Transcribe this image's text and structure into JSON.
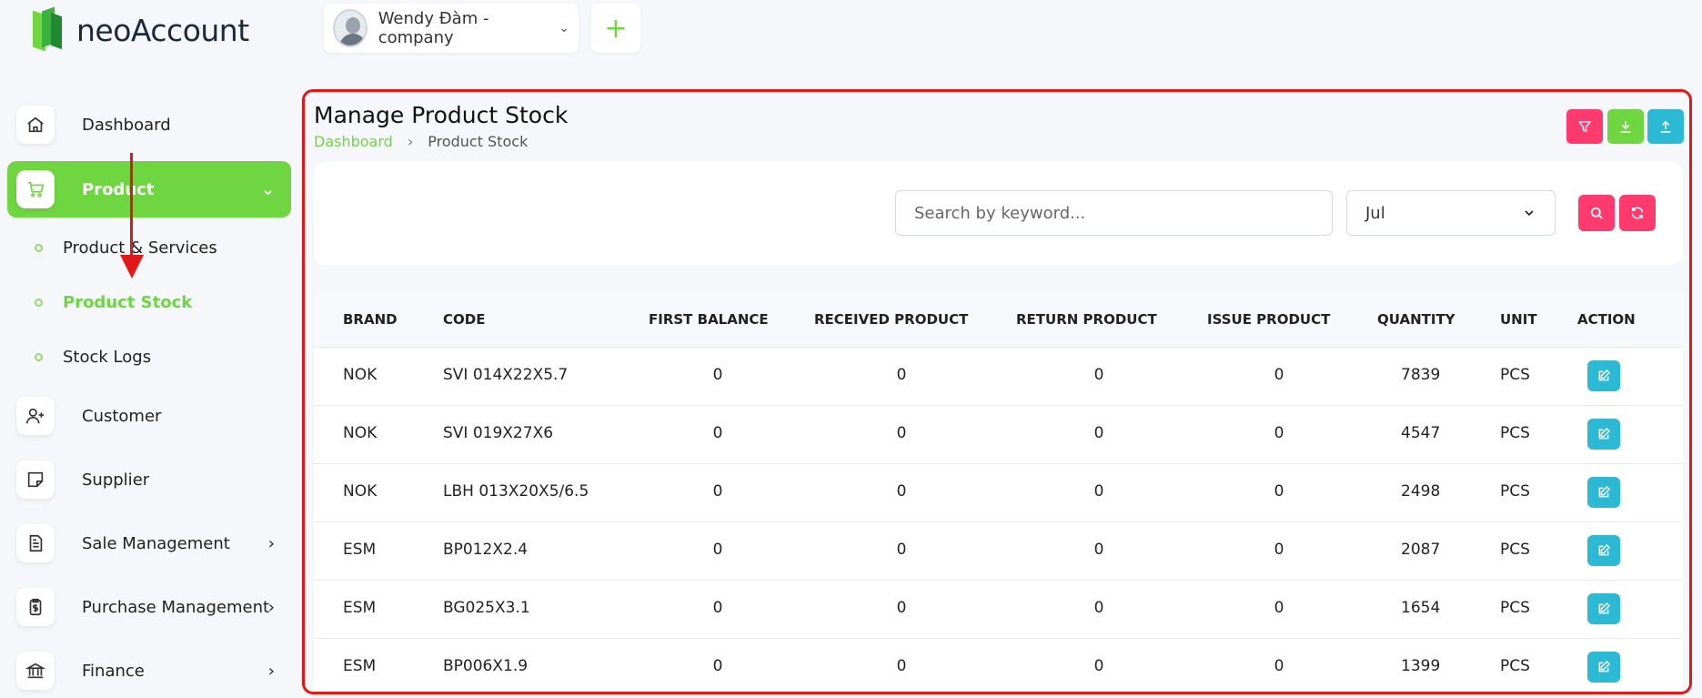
{
  "app": {
    "name": "neoAccount"
  },
  "header": {
    "company": "Wendy Đàm - company",
    "add_label": "+"
  },
  "sidebar": {
    "items": [
      {
        "label": "Dashboard",
        "icon": "home-icon"
      },
      {
        "label": "Product",
        "icon": "cart-icon"
      },
      {
        "label": "Customer",
        "icon": "user-plus-icon"
      },
      {
        "label": "Supplier",
        "icon": "sticky-note-icon"
      },
      {
        "label": "Sale Management",
        "icon": "invoice-icon"
      },
      {
        "label": "Purchase Management",
        "icon": "receipt-dollar-icon"
      },
      {
        "label": "Finance",
        "icon": "bank-icon"
      }
    ],
    "sub_items": [
      {
        "label": "Product & Services"
      },
      {
        "label": "Product Stock"
      },
      {
        "label": "Stock Logs"
      }
    ]
  },
  "page": {
    "title": "Manage Product Stock",
    "breadcrumb": {
      "home": "Dashboard",
      "current": "Product Stock"
    }
  },
  "filters": {
    "search_placeholder": "Search by keyword...",
    "month": "Jul"
  },
  "table": {
    "headers": [
      "BRAND",
      "CODE",
      "FIRST BALANCE",
      "RECEIVED PRODUCT",
      "RETURN PRODUCT",
      "ISSUE PRODUCT",
      "QUANTITY",
      "UNIT",
      "ACTION"
    ],
    "rows": [
      {
        "brand": "NOK",
        "code": "SVI 014X22X5.7",
        "first_balance": "0",
        "received": "0",
        "return": "0",
        "issue": "0",
        "quantity": "7839",
        "unit": "PCS"
      },
      {
        "brand": "NOK",
        "code": "SVI 019X27X6",
        "first_balance": "0",
        "received": "0",
        "return": "0",
        "issue": "0",
        "quantity": "4547",
        "unit": "PCS"
      },
      {
        "brand": "NOK",
        "code": "LBH 013X20X5/6.5",
        "first_balance": "0",
        "received": "0",
        "return": "0",
        "issue": "0",
        "quantity": "2498",
        "unit": "PCS"
      },
      {
        "brand": "ESM",
        "code": "BP012X2.4",
        "first_balance": "0",
        "received": "0",
        "return": "0",
        "issue": "0",
        "quantity": "2087",
        "unit": "PCS"
      },
      {
        "brand": "ESM",
        "code": "BG025X3.1",
        "first_balance": "0",
        "received": "0",
        "return": "0",
        "issue": "0",
        "quantity": "1654",
        "unit": "PCS"
      },
      {
        "brand": "ESM",
        "code": "BP006X1.9",
        "first_balance": "0",
        "received": "0",
        "return": "0",
        "issue": "0",
        "quantity": "1399",
        "unit": "PCS"
      }
    ]
  },
  "colors": {
    "accent": "#6fd642",
    "danger": "#ff3a6e",
    "info": "#2bb9d4",
    "annotation": "#e01818"
  }
}
